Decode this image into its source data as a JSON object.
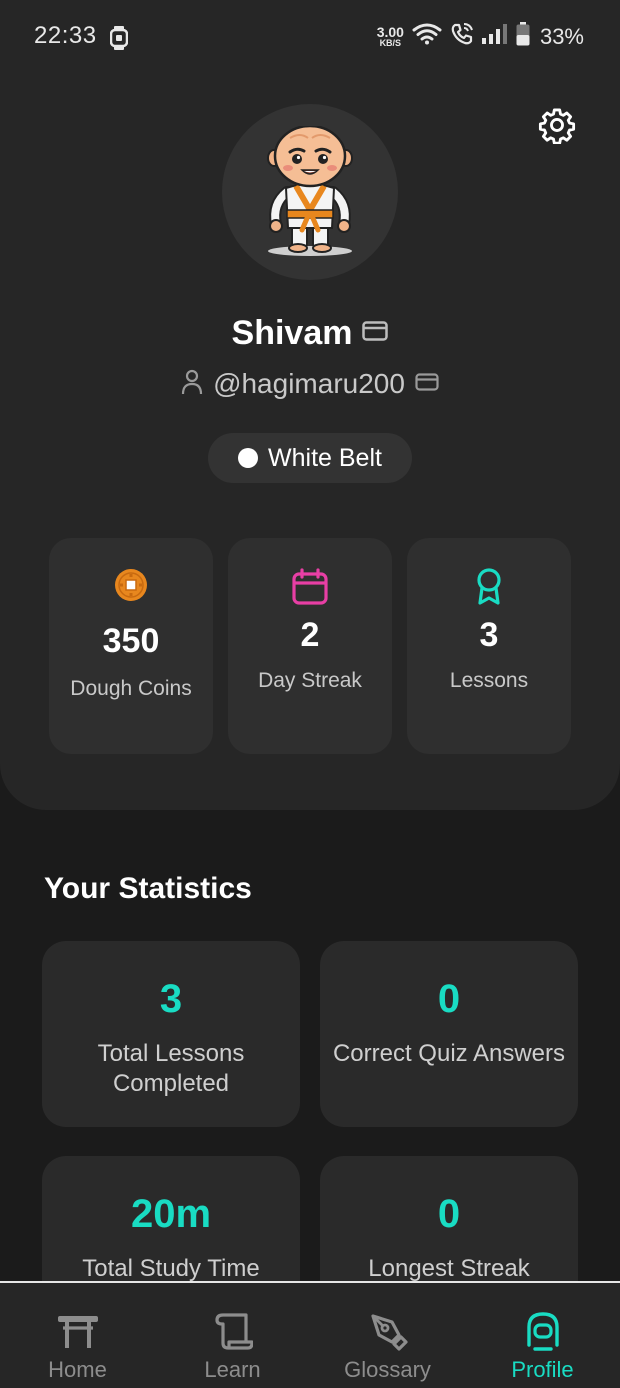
{
  "status_bar": {
    "time": "22:33",
    "net_speed_value": "3.00",
    "net_speed_unit": "KB/S",
    "battery": "33%"
  },
  "profile": {
    "name": "Shivam",
    "username": "@hagimaru200",
    "belt": "White Belt"
  },
  "hero_stats": [
    {
      "icon": "coin-icon",
      "value": "350",
      "label": "Dough Coins"
    },
    {
      "icon": "calendar-icon",
      "value": "2",
      "label": "Day Streak"
    },
    {
      "icon": "award-ribbon-icon",
      "value": "3",
      "label": "Lessons"
    }
  ],
  "statistics": {
    "title": "Your Statistics",
    "cards": [
      {
        "value": "3",
        "label": "Total Lessons Completed"
      },
      {
        "value": "0",
        "label": "Correct Quiz Answers"
      },
      {
        "value": "20m",
        "label": "Total Study Time"
      },
      {
        "value": "0",
        "label": "Longest Streak"
      }
    ]
  },
  "nav": {
    "items": [
      {
        "label": "Home",
        "icon": "torii-gate-icon"
      },
      {
        "label": "Learn",
        "icon": "scroll-icon"
      },
      {
        "label": "Glossary",
        "icon": "pen-nib-icon"
      },
      {
        "label": "Profile",
        "icon": "profile-icon",
        "active": true
      }
    ]
  },
  "colors": {
    "accent": "#19dcc3",
    "calendar": "#e83fa5",
    "coin": "#e8871e",
    "background": "#1b1b1b",
    "panel": "#262626",
    "card": "#2f2f2f"
  }
}
